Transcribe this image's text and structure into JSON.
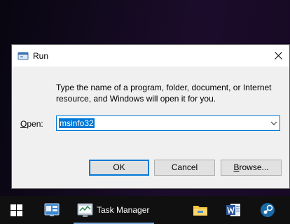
{
  "dialog": {
    "title": "Run",
    "description_line1": "Type the name of a program, folder, document, or Internet",
    "description_line2": "resource, and Windows will open it for you.",
    "open_label_prefix": "O",
    "open_label_rest": "pen:",
    "open_value": "msinfo32",
    "buttons": {
      "ok": "OK",
      "cancel": "Cancel",
      "browse_prefix": "B",
      "browse_rest": "rowse..."
    },
    "icons": {
      "app": "run-icon",
      "close": "close-icon",
      "dropdown": "chevron-down-icon"
    }
  },
  "taskbar": {
    "task_manager_label": "Task Manager",
    "icons": [
      "windows-start-icon",
      "control-panel-icon",
      "task-manager-icon",
      "file-explorer-icon",
      "word-icon",
      "steam-icon"
    ]
  },
  "colors": {
    "accent": "#0078d7",
    "dialog_bg": "#f0f0f0",
    "taskbar_bg": "#101010"
  }
}
